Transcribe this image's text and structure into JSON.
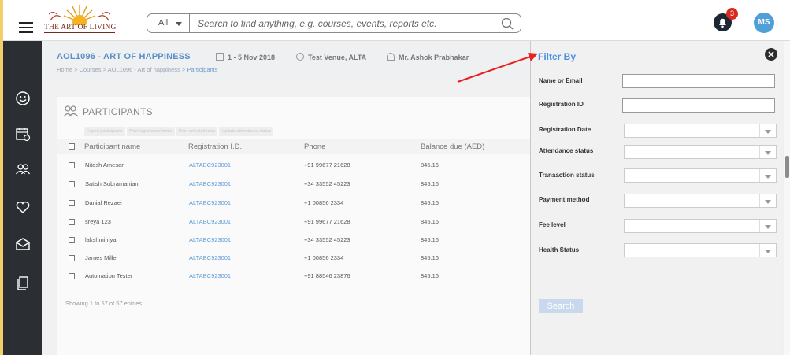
{
  "header": {
    "logo_text": "THE ART OF LIVING",
    "search_scope": "All",
    "search_placeholder": "Search to find anything, e.g. courses, events, reports etc.",
    "notification_count": "3",
    "user_initials": "MS"
  },
  "icons": {
    "menu": "hamburger-menu-icon",
    "search": "search-icon",
    "bell": "bell-icon",
    "close": "close-icon",
    "sidebar": [
      "smile-icon",
      "calendar-icon",
      "people-icon",
      "heart-icon",
      "mail-icon",
      "documents-icon"
    ]
  },
  "course": {
    "title": "AOL1096 - ART OF HAPPINESS",
    "dates": "1 - 5 Nov 2018",
    "venue": "Test Venue, ALTA",
    "teacher": "Mr. Ashok Prabhakar",
    "breadcrumb_path": "Home > Courses > AOL1096 - Art of happiness > ",
    "breadcrumb_current": "Participants"
  },
  "participants": {
    "title": "PARTICIPANTS",
    "actions": [
      "Export participants",
      "Print registration forms",
      "Print selected rows",
      "Update attendance status"
    ],
    "columns": [
      "Participant name",
      "Registration I.D.",
      "Phone",
      "Balance due (AED)"
    ],
    "rows": [
      {
        "name": "Nitesh Amesar",
        "reg_id": "ALTABC923001",
        "phone": "+91 99677 21628",
        "balance": "845.16"
      },
      {
        "name": "Satish Subramanian",
        "reg_id": "ALTABC923001",
        "phone": "+34 33552 45223",
        "balance": "845.16"
      },
      {
        "name": "Danial Rezaei",
        "reg_id": "ALTABC923001",
        "phone": "+1 00856 2334",
        "balance": "845.16"
      },
      {
        "name": "sreya 123",
        "reg_id": "ALTABC923001",
        "phone": "+91 99677 21628",
        "balance": "845.16"
      },
      {
        "name": "lakshmi riya",
        "reg_id": "ALTABC923001",
        "phone": "+34 33552 45223",
        "balance": "845.16"
      },
      {
        "name": "James Miller",
        "reg_id": "ALTABC923001",
        "phone": "+1 00856 2334",
        "balance": "845.16"
      },
      {
        "name": "Automation Tester",
        "reg_id": "ALTABC923001",
        "phone": "+91 88546 23876",
        "balance": "845.16"
      }
    ],
    "footer": "Showing 1 to 57 of 57 entries"
  },
  "filter": {
    "title": "Filter By",
    "fields": [
      {
        "label": "Name or Email",
        "kind": "text"
      },
      {
        "label": "Registration ID",
        "kind": "text"
      },
      {
        "label": "Registration Date",
        "kind": "select"
      },
      {
        "label": "Attendance status",
        "kind": "select"
      },
      {
        "label": "Tranaaction status",
        "kind": "select"
      },
      {
        "label": "Payment method",
        "kind": "select"
      },
      {
        "label": "Fee level",
        "kind": "select"
      },
      {
        "label": "Health Status",
        "kind": "select"
      }
    ],
    "search_label": "Search"
  },
  "colors": {
    "accent": "#4a90e2",
    "annotation_arrow": "#e8201f",
    "sidebar": "#2b2f33",
    "badge": "#d9291f"
  }
}
